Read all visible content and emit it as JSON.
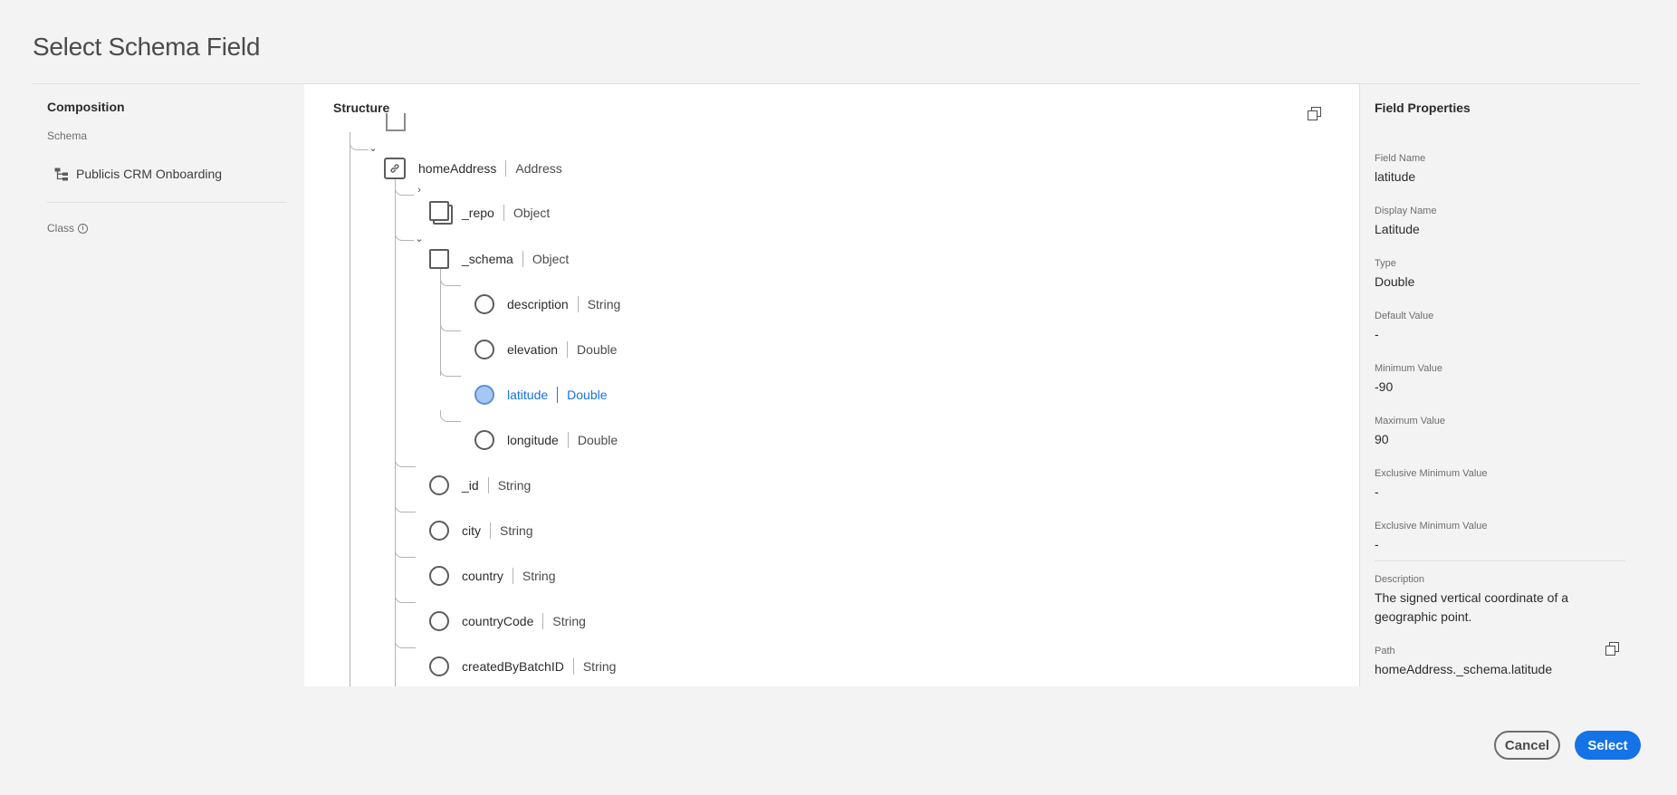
{
  "dialog": {
    "title": "Select Schema Field"
  },
  "composition": {
    "heading": "Composition",
    "schema_label": "Schema",
    "schema_name": "Publicis CRM Onboarding",
    "class_label": "Class"
  },
  "structure": {
    "heading": "Structure",
    "nodes": [
      {
        "name": "homeAddress",
        "type": "Address"
      },
      {
        "name": "_repo",
        "type": "Object"
      },
      {
        "name": "_schema",
        "type": "Object"
      },
      {
        "name": "description",
        "type": "String"
      },
      {
        "name": "elevation",
        "type": "Double"
      },
      {
        "name": "latitude",
        "type": "Double",
        "selected": true
      },
      {
        "name": "longitude",
        "type": "Double"
      },
      {
        "name": "_id",
        "type": "String"
      },
      {
        "name": "city",
        "type": "String"
      },
      {
        "name": "country",
        "type": "String"
      },
      {
        "name": "countryCode",
        "type": "String"
      },
      {
        "name": "createdByBatchID",
        "type": "String"
      }
    ]
  },
  "properties": {
    "heading": "Field Properties",
    "items": [
      {
        "label": "Field Name",
        "value": "latitude"
      },
      {
        "label": "Display Name",
        "value": "Latitude"
      },
      {
        "label": "Type",
        "value": "Double"
      },
      {
        "label": "Default Value",
        "value": "-"
      },
      {
        "label": "Minimum Value",
        "value": "-90"
      },
      {
        "label": "Maximum Value",
        "value": "90"
      },
      {
        "label": "Exclusive Minimum Value",
        "value": "-"
      },
      {
        "label": "Exclusive Minimum Value",
        "value": "-"
      },
      {
        "label": "Description",
        "value": "The signed vertical coordinate of a geographic point."
      },
      {
        "label": "Path",
        "value": "homeAddress._schema.latitude"
      }
    ]
  },
  "footer": {
    "cancel_label": "Cancel",
    "select_label": "Select"
  },
  "colors": {
    "accent": "#1473e6",
    "selected_fill": "#a5c8f3"
  }
}
